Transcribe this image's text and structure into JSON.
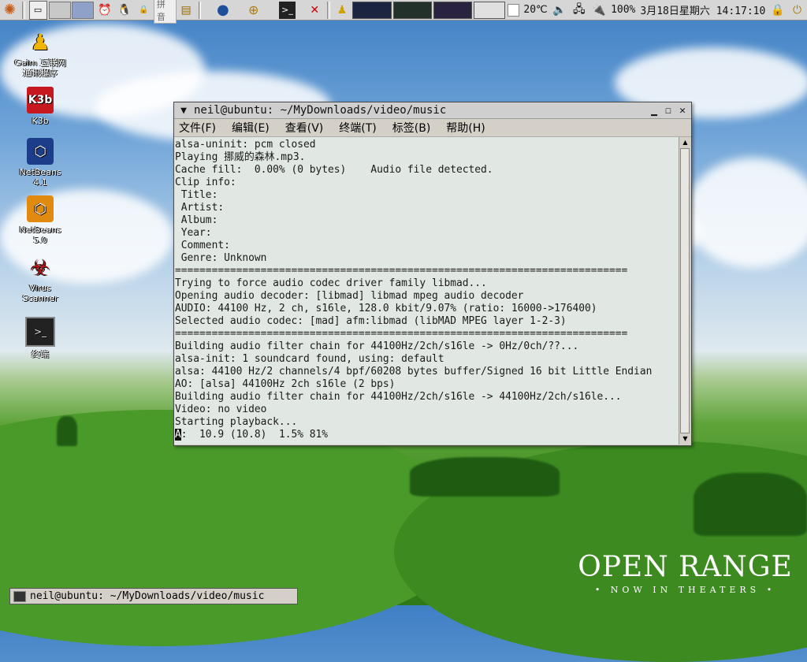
{
  "top_panel": {
    "input_method_label": "拼音",
    "temperature": "20℃",
    "battery": "100%",
    "clock": "3月18日星期六 14:17:10"
  },
  "desktop_icons": [
    {
      "label": "Gaim 互联网\n通讯程序",
      "icon": "gaim-icon"
    },
    {
      "label": "K3b",
      "icon": "k3b-icon"
    },
    {
      "label": "NetBeans\n4.1",
      "icon": "netbeans-icon"
    },
    {
      "label": "NetBeans\n5.0",
      "icon": "netbeans-icon"
    },
    {
      "label": "Virus\nScanner",
      "icon": "virus-scanner-icon"
    },
    {
      "label": "终端",
      "icon": "terminal-icon"
    }
  ],
  "terminal": {
    "title": "neil@ubuntu: ~/MyDownloads/video/music",
    "menu": [
      "文件(F)",
      "编辑(E)",
      "查看(V)",
      "终端(T)",
      "标签(B)",
      "帮助(H)"
    ],
    "lines": [
      "alsa-uninit: pcm closed",
      "Playing 挪威的森林.mp3.",
      "Cache fill:  0.00% (0 bytes)    Audio file detected.",
      "Clip info:",
      " Title:",
      " Artist:",
      " Album:",
      " Year:",
      " Comment:",
      " Genre: Unknown",
      "==========================================================================",
      "Trying to force audio codec driver family libmad...",
      "Opening audio decoder: [libmad] libmad mpeg audio decoder",
      "AUDIO: 44100 Hz, 2 ch, s16le, 128.0 kbit/9.07% (ratio: 16000->176400)",
      "Selected audio codec: [mad] afm:libmad (libMAD MPEG layer 1-2-3)",
      "==========================================================================",
      "Building audio filter chain for 44100Hz/2ch/s16le -> 0Hz/0ch/??...",
      "alsa-init: 1 soundcard found, using: default",
      "alsa: 44100 Hz/2 channels/4 bpf/60208 bytes buffer/Signed 16 bit Little Endian",
      "AO: [alsa] 44100Hz 2ch s16le (2 bps)",
      "Building audio filter chain for 44100Hz/2ch/s16le -> 44100Hz/2ch/s16le...",
      "Video: no video",
      "Starting playback..."
    ],
    "status_cursor_char": "A",
    "status_rest": ":  10.9 (10.8)  1.5% 81%"
  },
  "taskbar": {
    "window_title": "neil@ubuntu: ~/MyDownloads/video/music"
  },
  "wallpaper_promo": {
    "title": "OPEN RANGE",
    "subtitle": "• NOW IN THEATERS •"
  }
}
